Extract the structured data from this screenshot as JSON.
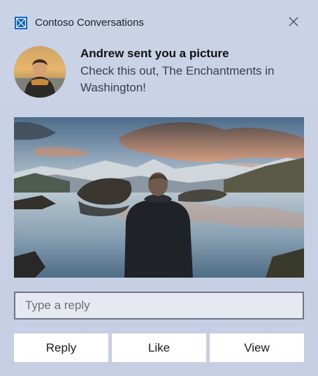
{
  "app": {
    "name": "Contoso Conversations",
    "icon": "app-logo-icon",
    "accent_color": "#0b5fc9"
  },
  "header": {
    "close_icon": "close-icon"
  },
  "notification": {
    "title": "Andrew sent you a picture",
    "body": "Check this out, The Enchantments in Washington!",
    "avatar": "avatar"
  },
  "reply": {
    "placeholder": "Type a reply",
    "value": ""
  },
  "actions": {
    "reply_label": "Reply",
    "like_label": "Like",
    "view_label": "View"
  }
}
